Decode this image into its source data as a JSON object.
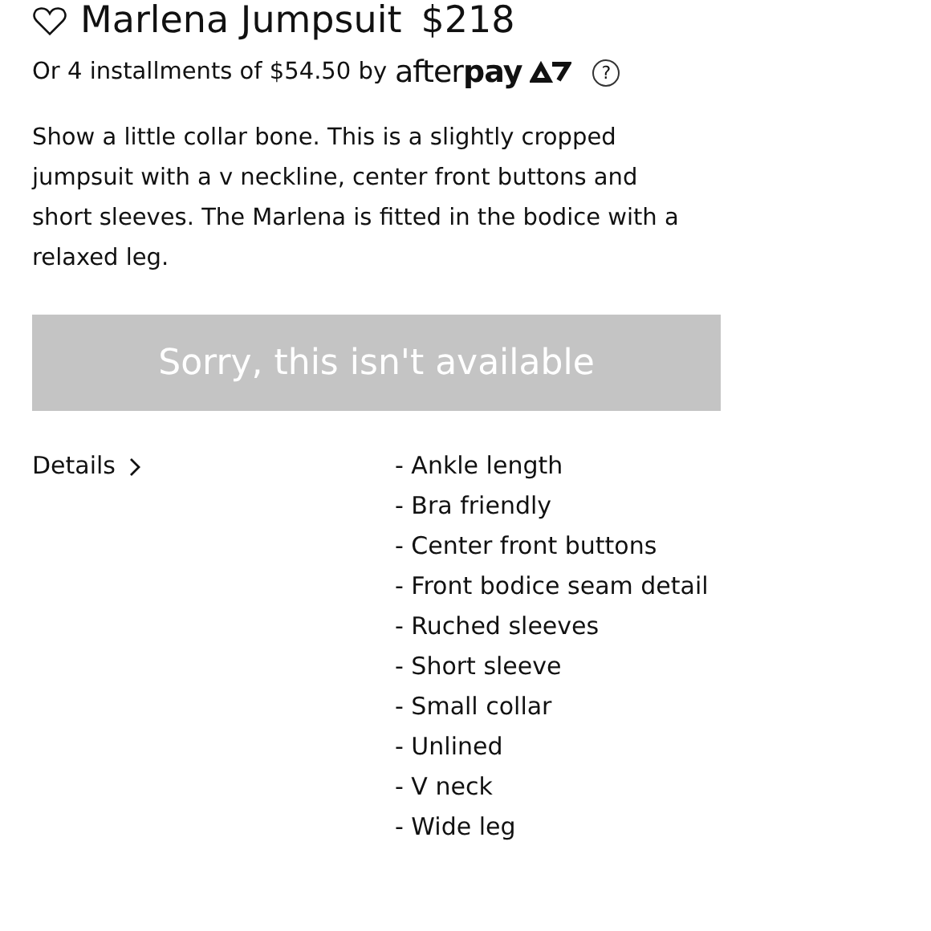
{
  "product": {
    "favorite": false,
    "name": "Marlena Jumpsuit",
    "price": "$218"
  },
  "installments": {
    "text": "Or 4 installments of $54.50 by",
    "provider": "after**pay**",
    "help": "?"
  },
  "description": "Show a little collar bone. This is a slightly cropped jumpsuit with a v neckline, center front buttons and short sleeves. The Marlena is fitted in the bodice with a relaxed leg.",
  "add_button": {
    "label": "Sorry, this isn't available",
    "disabled": true
  },
  "details": {
    "label": "Details",
    "expanded": false,
    "items": [
      "- Ankle length",
      "- Bra friendly",
      "- Center front buttons",
      "- Front bodice seam detail",
      "- Ruched sleeves",
      "- Short sleeve",
      "- Small collar",
      "- Unlined",
      "- V neck",
      "- Wide leg"
    ]
  }
}
